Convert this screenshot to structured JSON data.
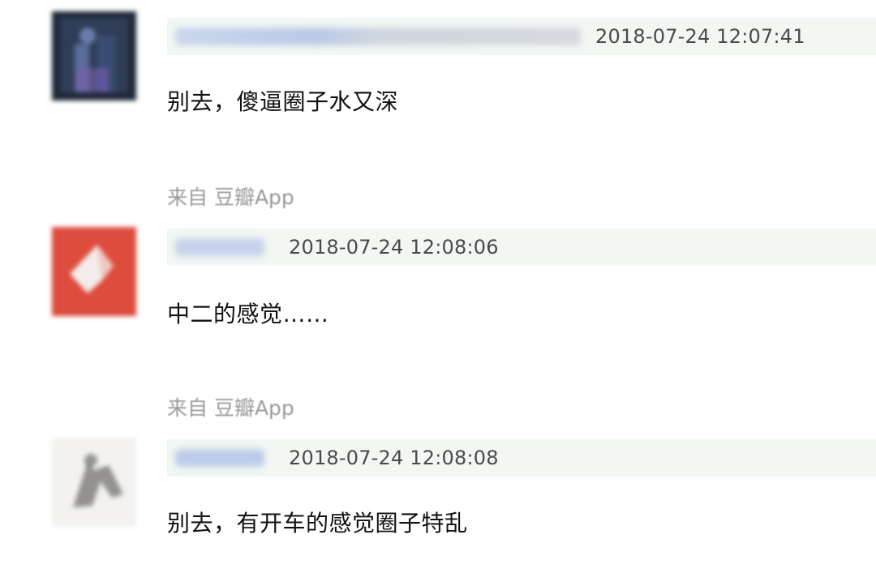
{
  "comments": [
    {
      "timestamp": "2018-07-24 12:07:41",
      "text": "别去，傻逼圈子水又深"
    },
    {
      "source": "来自 豆瓣App",
      "timestamp": "2018-07-24 12:08:06",
      "text": "中二的感觉……"
    },
    {
      "source": "来自 豆瓣App",
      "timestamp": "2018-07-24 12:08:08",
      "text": "别去，有开车的感觉圈子特乱"
    }
  ],
  "colors": {
    "header_bg": "#f3f7f3",
    "username_blur": "#c3cfe6",
    "source_text": "#9a9a9a",
    "timestamp_text": "#4a4a4a"
  },
  "icons": {
    "avatar_1": "dark-photo-avatar",
    "avatar_2": "red-square-avatar",
    "avatar_3": "sketch-avatar"
  }
}
